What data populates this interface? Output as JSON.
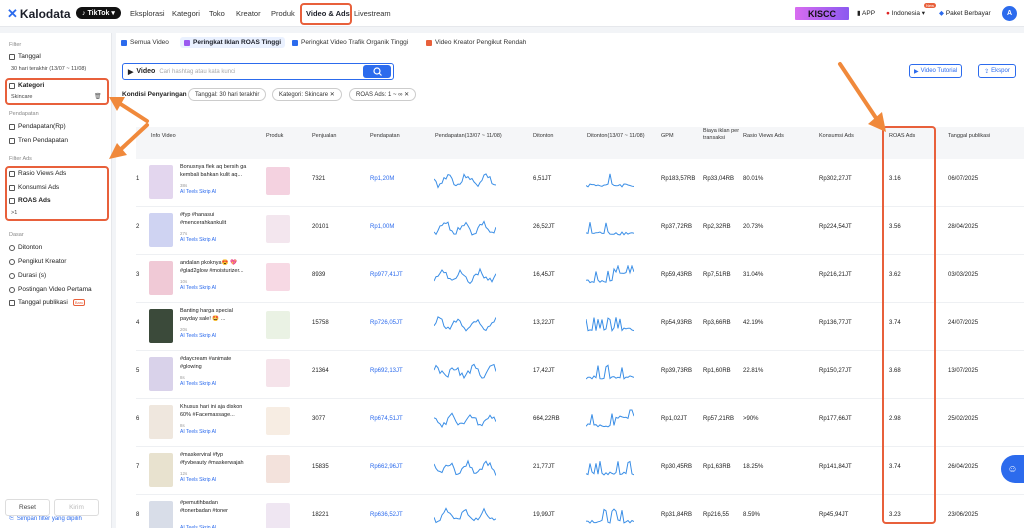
{
  "app": {
    "logo": "Kalodata",
    "platform": "TikTok"
  },
  "nav": {
    "items": [
      "Eksplorasi",
      "Kategori",
      "Toko",
      "Kreator",
      "Produk",
      "Video & Ads",
      "Livestream"
    ],
    "active": "Video & Ads"
  },
  "topright": {
    "promo": "KISCC",
    "app": "APP",
    "country": "Indonesia",
    "country_badge": "New",
    "plan": "Paket Berbayar",
    "avatar": "A"
  },
  "sidebar": {
    "filter_label": "Filter",
    "tanggal_label": "Tanggal",
    "tanggal_value": "30 hari terakhir (13/07 ~ 11/08)",
    "kategori_label": "Kategori",
    "kategori_value": "Skincare",
    "pendapatan_section": "Pendapatan",
    "pendapatan_rp": "Pendapatan(Rp)",
    "tren_pendapatan": "Tren Pendapatan",
    "filter_ads_section": "Filter Ads",
    "rasio_views_ads": "Rasio Views Ads",
    "konsumsi_ads": "Konsumsi Ads",
    "roas_ads": "ROAS Ads",
    "roas_value": ">1",
    "dasar_section": "Dasar",
    "ditonton": "Ditonton",
    "pengikut_kreator": "Pengikut Kreator",
    "durasi": "Durasi (s)",
    "postingan_video_pertama": "Postingan Video Pertama",
    "tanggal_publikasi": "Tanggal publikasi",
    "new_badge": "Baru",
    "save_filter": "Simpan filter yang dipilih",
    "reset": "Reset",
    "kirim": "Kirim"
  },
  "tabs": [
    "Semua Video",
    "Peringkat Iklan ROAS Tinggi",
    "Peringkat Video Trafik Organik Tinggi",
    "Video Kreator Pengikut Rendah"
  ],
  "search": {
    "label": "Video",
    "placeholder": "Cari hashtag atau kata kunci"
  },
  "buttons": {
    "tutorial": "Video Tutorial",
    "export": "Ekspor"
  },
  "conditions": {
    "label": "Kondisi Penyaringan",
    "chips": [
      "Tanggal: 30 hari terakhir",
      "Kategori: Skincare",
      "ROAS Ads: 1 ~ ∞"
    ]
  },
  "table": {
    "headers": [
      "Info Video",
      "Produk",
      "Penjualan",
      "Pendapatan",
      "Pendapatan(13/07 ~ 11/08)",
      "Ditonton",
      "Ditonton(13/07 ~ 11/08)",
      "GPM",
      "Biaya iklan per transaksi",
      "Rasio Views Ads",
      "Konsumsi Ads",
      "ROAS Ads",
      "Tanggal publikasi"
    ],
    "ai_label": "Teels Skrip AI",
    "rows": [
      {
        "rank": "1",
        "line1": "Bonusnya flek aq bersih ga",
        "line2": "kembali bahkan kulit aq...",
        "duration": "38s",
        "penjualan": "7321",
        "pendapatan": "Rp1,20M",
        "ditonton": "6,51JT",
        "gpm": "Rp183,57RB",
        "biaya": "Rp33,04RB",
        "rasio": "80.01%",
        "konsumsi": "Rp302,27JT",
        "roas": "3.16",
        "tanggal": "06/07/2025"
      },
      {
        "rank": "2",
        "line1": "#fyp #hanasui",
        "line2": "#mencerahkankulit",
        "duration": "27s",
        "penjualan": "20101",
        "pendapatan": "Rp1,00M",
        "ditonton": "26,52JT",
        "gpm": "Rp37,72RB",
        "biaya": "Rp2,32RB",
        "rasio": "20.73%",
        "konsumsi": "Rp224,54JT",
        "roas": "3.56",
        "tanggal": "28/04/2025"
      },
      {
        "rank": "3",
        "line1": "andalan pkoknya😍 💖",
        "line2": "#glad2glow #moisturizer...",
        "duration": "10s",
        "penjualan": "8939",
        "pendapatan": "Rp977,41JT",
        "ditonton": "16,45JT",
        "gpm": "Rp59,43RB",
        "biaya": "Rp7,51RB",
        "rasio": "31.04%",
        "konsumsi": "Rp216,21JT",
        "roas": "3.62",
        "tanggal": "03/03/2025"
      },
      {
        "rank": "4",
        "line1": "Banting harga special",
        "line2": "payday sale! 🤩 ...",
        "duration": "20s",
        "penjualan": "15758",
        "pendapatan": "Rp726,05JT",
        "ditonton": "13,22JT",
        "gpm": "Rp54,93RB",
        "biaya": "Rp3,66RB",
        "rasio": "42.19%",
        "konsumsi": "Rp136,77JT",
        "roas": "3.74",
        "tanggal": "24/07/2025"
      },
      {
        "rank": "5",
        "line1": "#daycream #animate",
        "line2": "#glowing",
        "duration": "8s",
        "penjualan": "21364",
        "pendapatan": "Rp692,13JT",
        "ditonton": "17,42JT",
        "gpm": "Rp39,73RB",
        "biaya": "Rp1,60RB",
        "rasio": "22.81%",
        "konsumsi": "Rp150,27JT",
        "roas": "3.68",
        "tanggal": "13/07/2025"
      },
      {
        "rank": "6",
        "line1": "Khusus hari ini aja diskon",
        "line2": "60% #Facemassage...",
        "duration": "8s",
        "penjualan": "3077",
        "pendapatan": "Rp674,51JT",
        "ditonton": "664,22RB",
        "gpm": "Rp1,02JT",
        "biaya": "Rp57,21RB",
        "rasio": ">90%",
        "konsumsi": "Rp177,66JT",
        "roas": "2.98",
        "tanggal": "25/02/2025"
      },
      {
        "rank": "7",
        "line1": "#maskerviral #fyp",
        "line2": "#fyvbeauty #maskerwajah",
        "duration": "12s",
        "penjualan": "15835",
        "pendapatan": "Rp662,96JT",
        "ditonton": "21,77JT",
        "gpm": "Rp30,45RB",
        "biaya": "Rp1,63RB",
        "rasio": "18.25%",
        "konsumsi": "Rp141,84JT",
        "roas": "3.74",
        "tanggal": "26/04/2025"
      },
      {
        "rank": "8",
        "line1": "#pemutihbadan",
        "line2": "#tonerbadan #toner",
        "duration": "",
        "penjualan": "18221",
        "pendapatan": "Rp636,52JT",
        "ditonton": "19,99JT",
        "gpm": "Rp31,84RB",
        "biaya": "Rp216,55",
        "rasio": "8.59%",
        "konsumsi": "Rp45,94JT",
        "roas": "3.23",
        "tanggal": "23/06/2025"
      }
    ]
  },
  "colors": {
    "accent": "#2c6bed",
    "highlight": "#e8603b"
  }
}
